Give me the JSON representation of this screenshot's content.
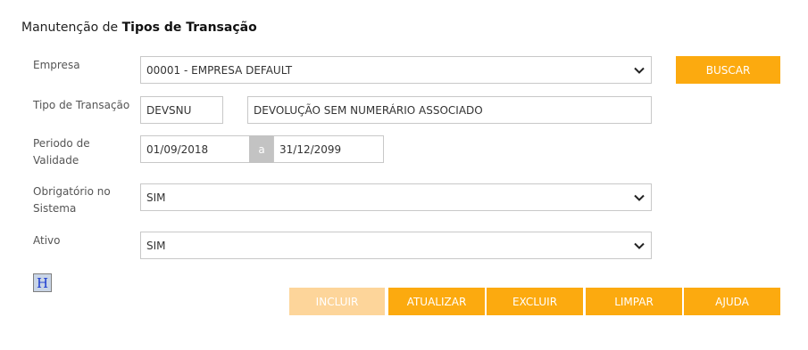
{
  "page": {
    "title_prefix": "Manutenção de ",
    "title_bold": "Tipos de Transação"
  },
  "form": {
    "empresa": {
      "label": "Empresa",
      "value": "00001 - EMPRESA DEFAULT",
      "icon": "chevron-down-icon"
    },
    "tipo": {
      "label": "Tipo de Transação",
      "code": "DEVSNU",
      "description": "DEVOLUÇÃO SEM NUMERÁRIO ASSOCIADO"
    },
    "periodo": {
      "label_line1": "Periodo de",
      "label_line2": "Validade",
      "start": "01/09/2018",
      "separator": "a",
      "end": "31/12/2099"
    },
    "obrigatorio": {
      "label_line1": "Obrigatório no",
      "label_line2": "Sistema",
      "value": "SIM",
      "icon": "chevron-down-icon"
    },
    "ativo": {
      "label": "Ativo",
      "value": "SIM",
      "icon": "chevron-down-icon"
    }
  },
  "buttons": {
    "buscar": "BUSCAR",
    "incluir": "INCLUIR",
    "atualizar": "ATUALIZAR",
    "excluir": "EXCLUIR",
    "limpar": "LIMPAR",
    "ajuda": "AJUDA"
  },
  "help_icon": {
    "letter": "H",
    "icon": "help-h-icon"
  },
  "colors": {
    "accent": "#fcaa0f",
    "accent_disabled": "#fdd59a",
    "separator": "#c3c3c3",
    "border": "#c8c8c8"
  }
}
